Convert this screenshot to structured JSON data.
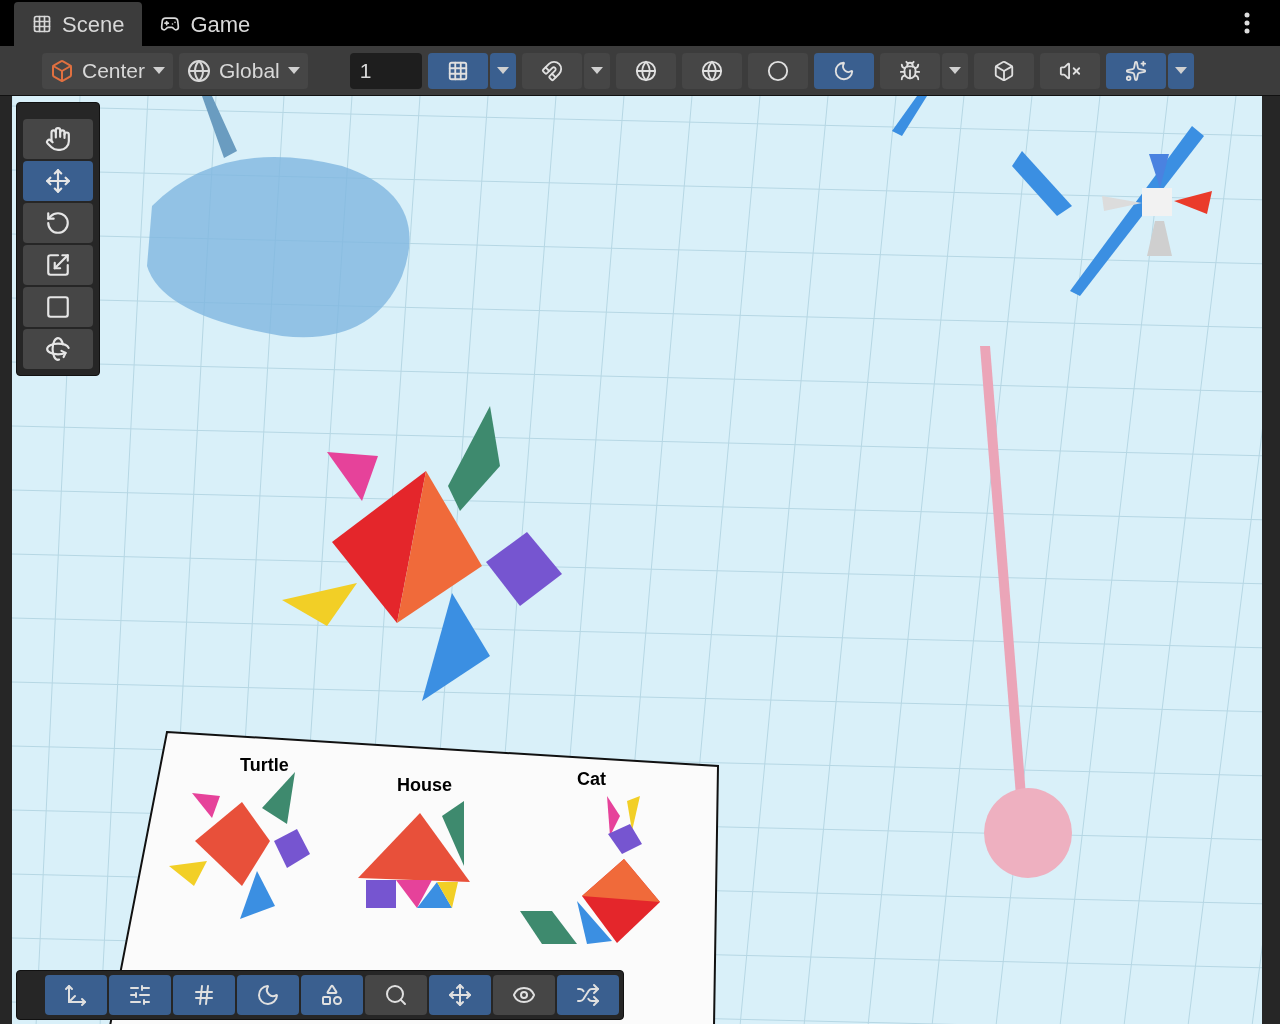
{
  "tabs": [
    {
      "label": "Scene",
      "kind": "scene",
      "selected": true
    },
    {
      "label": "Game",
      "kind": "game",
      "selected": false
    }
  ],
  "toolbar": {
    "pivot": {
      "label": "Center"
    },
    "space": {
      "label": "Global"
    },
    "grid_size": {
      "value": "1"
    },
    "toggles": [
      {
        "kind": "grid",
        "selected": true,
        "dropdown": true
      },
      {
        "kind": "snap",
        "selected": false,
        "dropdown": true
      },
      {
        "kind": "wireframe",
        "selected": false,
        "dropdown": false
      },
      {
        "kind": "shaded-wireframe",
        "selected": false,
        "dropdown": false
      },
      {
        "kind": "shaded",
        "selected": false,
        "dropdown": false
      },
      {
        "kind": "lighting",
        "selected": true,
        "dropdown": false
      },
      {
        "kind": "debug",
        "selected": false,
        "dropdown": true
      },
      {
        "kind": "flat",
        "selected": false,
        "dropdown": false
      },
      {
        "kind": "audio",
        "selected": false,
        "dropdown": false
      },
      {
        "kind": "effects",
        "selected": true,
        "dropdown": true
      }
    ]
  },
  "tools": [
    {
      "kind": "hand",
      "selected": false
    },
    {
      "kind": "move",
      "selected": true
    },
    {
      "kind": "rotate",
      "selected": false
    },
    {
      "kind": "scale",
      "selected": false
    },
    {
      "kind": "rect",
      "selected": false
    },
    {
      "kind": "transform",
      "selected": false
    }
  ],
  "overlay_toolbar": [
    {
      "kind": "move",
      "selected": true
    },
    {
      "kind": "sliders",
      "selected": true
    },
    {
      "kind": "grid",
      "selected": true
    },
    {
      "kind": "lighting",
      "selected": true
    },
    {
      "kind": "shapes",
      "selected": true
    },
    {
      "kind": "search",
      "selected": false
    },
    {
      "kind": "gizmo",
      "selected": true
    },
    {
      "kind": "visibility",
      "selected": false
    },
    {
      "kind": "shuffle",
      "selected": true
    }
  ],
  "scene": {
    "card_labels": [
      "Turtle",
      "House",
      "Cat"
    ]
  }
}
